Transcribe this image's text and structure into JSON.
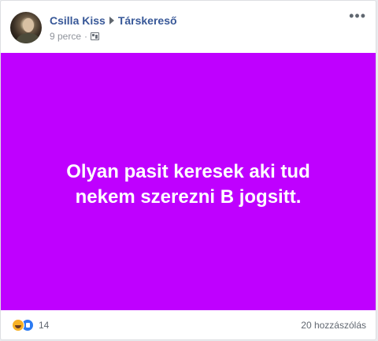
{
  "post": {
    "author": "Csilla Kiss",
    "group": "Társkereső",
    "time": "9 perce",
    "separator": "·",
    "background_color": "#bf00ff",
    "text_line1": "Olyan pasit keresek aki tud",
    "text_line2": "nekem szerezni B jogsitt.",
    "audience_icon": "group-audience-icon",
    "more_icon": "•••"
  },
  "footer": {
    "reaction_icons": [
      "haha-icon",
      "like-icon"
    ],
    "reaction_count": "14",
    "comment_count": "20 hozzászólás"
  }
}
